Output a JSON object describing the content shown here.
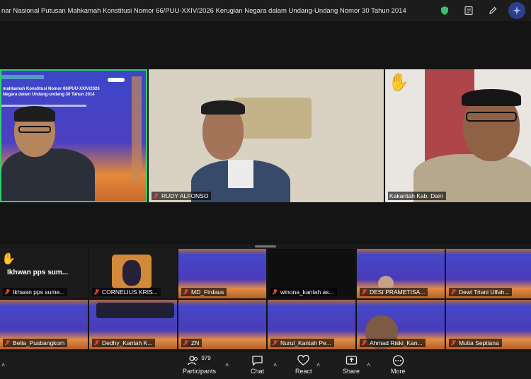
{
  "window": {
    "title": "nar Nasional Putusan Mahkamah Konstitusi Nomor 66/PUU-XXIV/2026 Kerugian Negara dalam Undang-Undang Nomor 30 Tahun 2014"
  },
  "slide": {
    "line1": "mahkamah Konstitusi Nomor 66/PUU-XXIV/2026",
    "line2": "Negara dalam Undang-undang 30 Tahun 2014"
  },
  "participants_main": [
    {
      "name": ""
    },
    {
      "name": "RUDY ALFONSO"
    },
    {
      "name": "Kakantah Kab. Dairi"
    }
  ],
  "small_tiles": [
    {
      "name": "Ikhwan pps sume...",
      "display": "Ikhwan pps sum..."
    },
    {
      "name": "CORNELIUS KRIS..."
    },
    {
      "name": "MD_Firdaus"
    },
    {
      "name": "winona_kantah as..."
    },
    {
      "name": "DESI PRAMETISA..."
    },
    {
      "name": "Dewi Triani Ulfah..."
    },
    {
      "name": "Bella_Pusbangkom"
    },
    {
      "name": "Dedhy_Kantah K..."
    },
    {
      "name": "ZN"
    },
    {
      "name": "Nurul_Kantah Pe..."
    },
    {
      "name": "Ahmad Riski_Kan..."
    },
    {
      "name": "Mutia Septiana"
    }
  ],
  "toolbar": {
    "participants_label": "Participants",
    "participants_count": "979",
    "chat_label": "Chat",
    "react_label": "React",
    "share_label": "Share",
    "more_label": "More"
  },
  "icons": {
    "shield": "shield-icon",
    "notes": "notes-icon",
    "edit": "edit-icon",
    "ai": "ai-companion-icon"
  },
  "colors": {
    "accent_green": "#33c26a",
    "muted_red": "#e04040",
    "slide_blue": "#3b47c8",
    "slide_orange": "#e58a3a"
  }
}
